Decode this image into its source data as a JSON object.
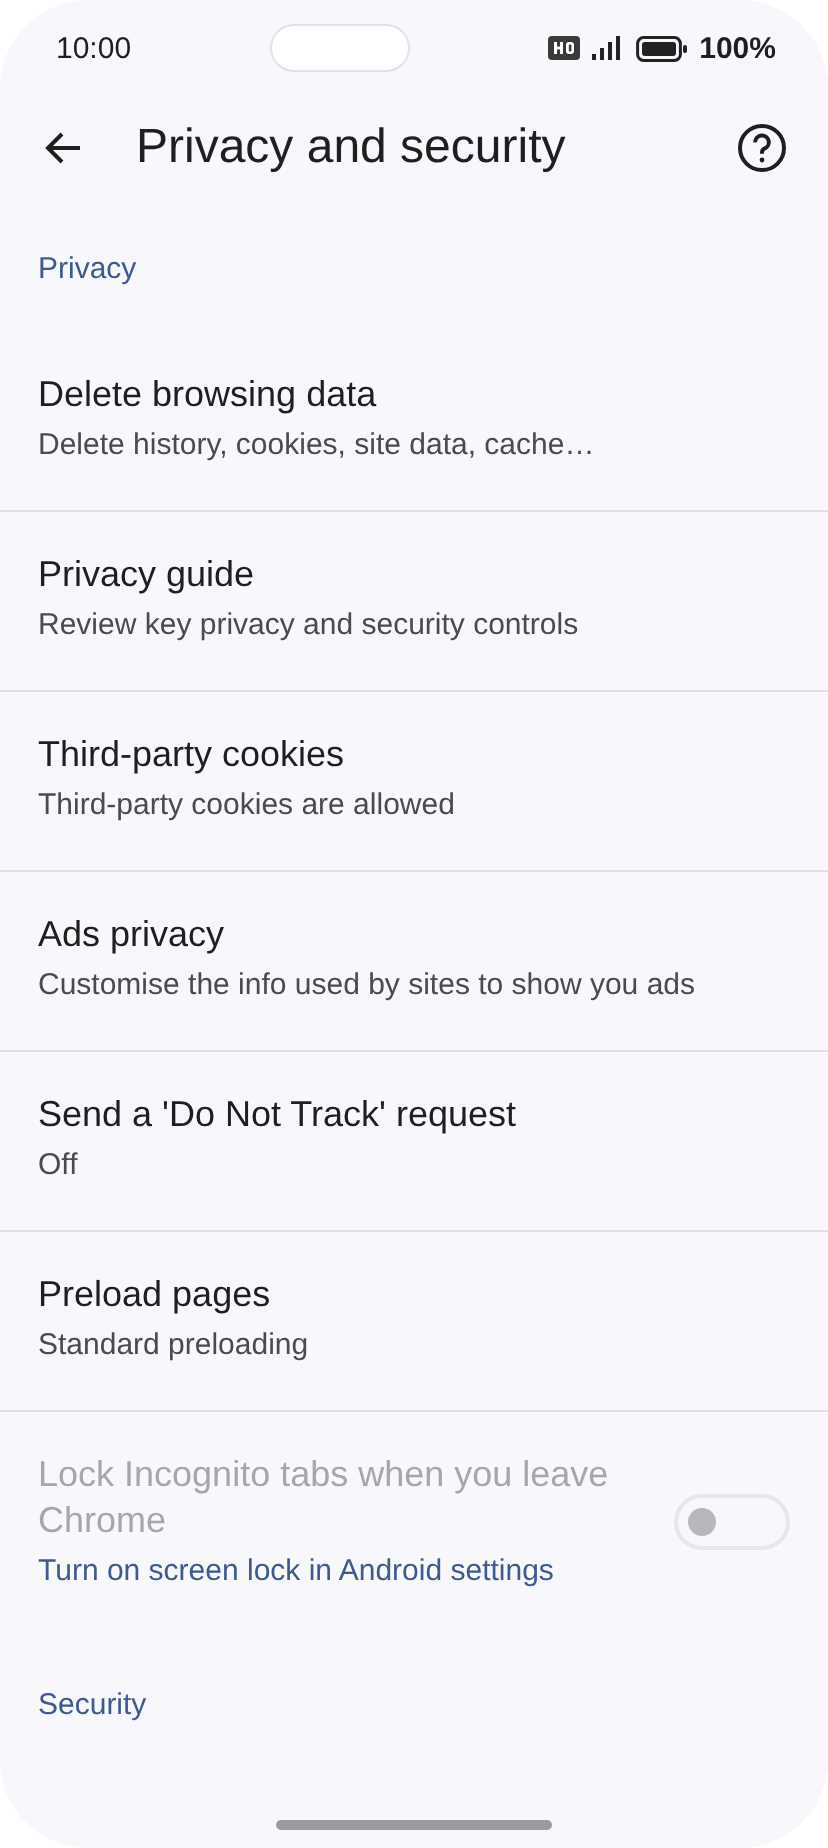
{
  "status_bar": {
    "time": "10:00",
    "battery": "100%"
  },
  "header": {
    "title": "Privacy and security"
  },
  "sections": [
    {
      "label": "Privacy",
      "items": [
        {
          "kind": "link",
          "title": "Delete browsing data",
          "subtitle": "Delete history, cookies, site data, cache…"
        },
        {
          "kind": "link",
          "title": "Privacy guide",
          "subtitle": "Review key privacy and security controls"
        },
        {
          "kind": "link",
          "title": "Third-party cookies",
          "subtitle": "Third-party cookies are allowed"
        },
        {
          "kind": "link",
          "title": "Ads privacy",
          "subtitle": "Customise the info used by sites to show you ads"
        },
        {
          "kind": "link",
          "title": "Send a 'Do Not Track' request",
          "subtitle": "Off"
        },
        {
          "kind": "link",
          "title": "Preload pages",
          "subtitle": "Standard preloading"
        },
        {
          "kind": "toggle",
          "title": "Lock Incognito tabs when you leave Chrome",
          "subtitle": "Turn on screen lock in Android settings",
          "on": false,
          "disabled": true
        }
      ]
    },
    {
      "label": "Security"
    }
  ]
}
